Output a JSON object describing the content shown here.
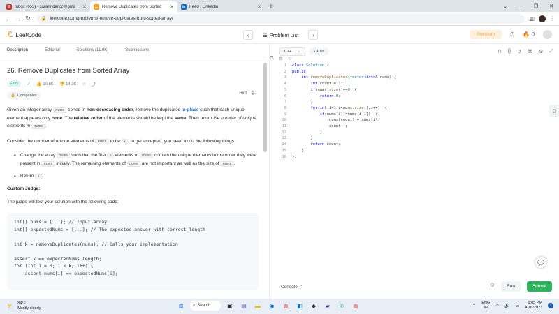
{
  "browser": {
    "tabs": [
      {
        "title": "Inbox (653) - saranrider22@gma",
        "icon": "gmail-icon"
      },
      {
        "title": "Remove Duplicates from Sorted",
        "icon": "leetcode-icon"
      },
      {
        "title": "Feed | LinkedIn",
        "icon": "linkedin-icon"
      }
    ],
    "url": "leetcode.com/problems/remove-duplicates-from-sorted-array/"
  },
  "header": {
    "logo_text": "LeetCode",
    "problem_list": "Problem List",
    "premium": "Premium",
    "fire_count": "0"
  },
  "desc_tabs": [
    "Description",
    "Editorial",
    "Solutions (11.9K)",
    "Submissions"
  ],
  "problem": {
    "title": "26. Remove Duplicates from Sorted Array",
    "hint": "Hint",
    "difficulty": "Easy",
    "likes": "10.6K",
    "dislikes": "14.3K",
    "companies": "Companies",
    "custom_judge": "Custom Judge:",
    "judge_intro": "The judge will test your solution with the following code:",
    "judge_code": "int[] nums = [...]; // Input array\nint[] expectedNums = [...]; // The expected answer with correct length\n\nint k = removeDuplicates(nums); // Calls your implementation\n\nassert k == expectedNums.length;\nfor (int i = 0; i < k; i++) {\n    assert nums[i] == expectedNums[i];"
  },
  "editor": {
    "language": "C++",
    "mode": "Auto",
    "line_numbers": [
      "1",
      "2",
      "3",
      "4",
      "5",
      "6",
      "7",
      "8",
      "9",
      "10",
      "11",
      "12",
      "13",
      "14",
      "15",
      "16"
    ],
    "console": "Console",
    "run": "Run",
    "submit": "Submit"
  },
  "taskbar": {
    "temp": "84°F",
    "weather": "Mostly cloudy",
    "search": "Search",
    "lang1": "ENG",
    "lang2": "IN",
    "time": "9:05 PM",
    "date": "4/16/2023",
    "notifications": "1"
  },
  "colors": {
    "accent_orange": "#f89f1b",
    "easy_green": "#00af9b",
    "submit_green": "#2db55d",
    "link_blue": "#1a7ee0"
  }
}
